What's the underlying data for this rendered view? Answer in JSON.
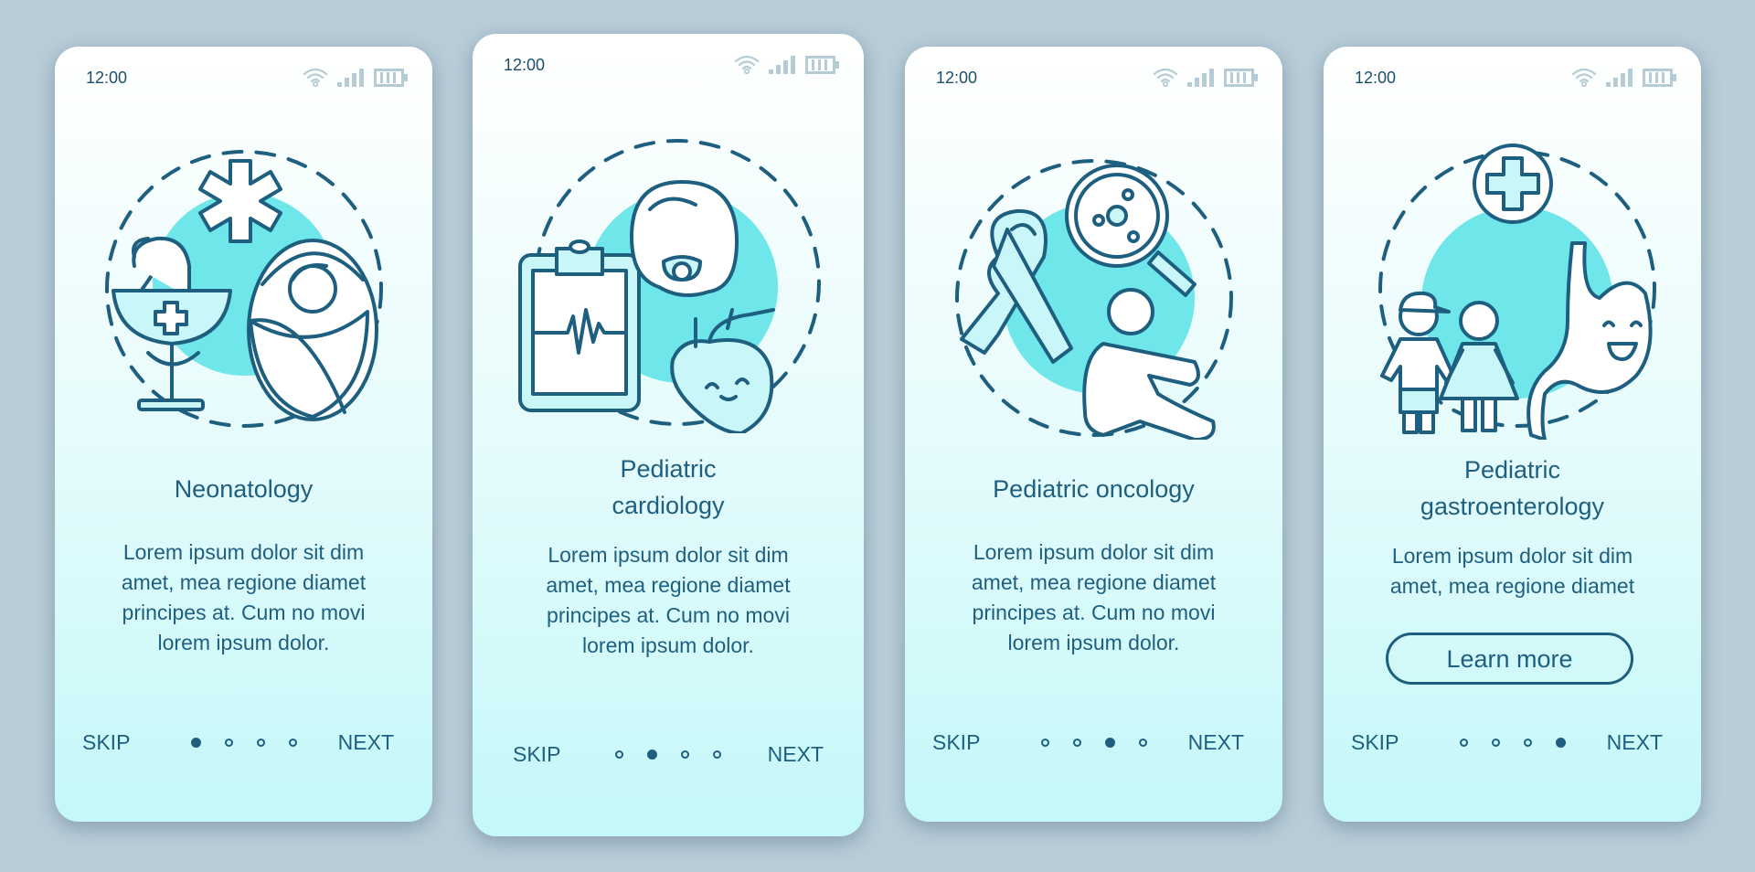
{
  "colors": {
    "background": "#b8cdd8",
    "ink": "#1e5f80",
    "accent_circle": "#6ee6ea",
    "light_fill": "#c9f6f8",
    "status_icons": "#b5ccd6"
  },
  "screens": [
    {
      "time": "12:00",
      "status_icons": [
        "wifi-icon",
        "signal-icon",
        "battery-icon"
      ],
      "illustration": "neonatology-illustration",
      "title": "Neonatology",
      "description_lines": [
        "Lorem ipsum dolor sit dim",
        "amet, mea regione diamet",
        "principes at. Cum no movi",
        "lorem ipsum dolor."
      ],
      "skip_label": "SKIP",
      "next_label": "NEXT",
      "page_index": 1,
      "page_count": 4
    },
    {
      "time": "12:00",
      "status_icons": [
        "wifi-icon",
        "signal-icon",
        "battery-icon"
      ],
      "illustration": "pediatric-cardiology-illustration",
      "title_lines": [
        "Pediatric",
        "cardiology"
      ],
      "description_lines": [
        "Lorem ipsum dolor sit dim",
        "amet, mea regione diamet",
        "principes at. Cum no movi",
        "lorem ipsum dolor."
      ],
      "skip_label": "SKIP",
      "next_label": "NEXT",
      "page_index": 2,
      "page_count": 4
    },
    {
      "time": "12:00",
      "status_icons": [
        "wifi-icon",
        "signal-icon",
        "battery-icon"
      ],
      "illustration": "pediatric-oncology-illustration",
      "title": "Pediatric oncology",
      "description_lines": [
        "Lorem ipsum dolor sit dim",
        "amet, mea regione diamet",
        "principes at. Cum no movi",
        "lorem ipsum dolor."
      ],
      "skip_label": "SKIP",
      "next_label": "NEXT",
      "page_index": 3,
      "page_count": 4
    },
    {
      "time": "12:00",
      "status_icons": [
        "wifi-icon",
        "signal-icon",
        "battery-icon"
      ],
      "illustration": "pediatric-gastroenterology-illustration",
      "title_lines": [
        "Pediatric",
        "gastroenterology"
      ],
      "description_lines": [
        "Lorem ipsum dolor sit dim",
        "amet, mea regione diamet"
      ],
      "button_label": "Learn more",
      "skip_label": "SKIP",
      "next_label": "NEXT",
      "page_index": 4,
      "page_count": 4
    }
  ]
}
